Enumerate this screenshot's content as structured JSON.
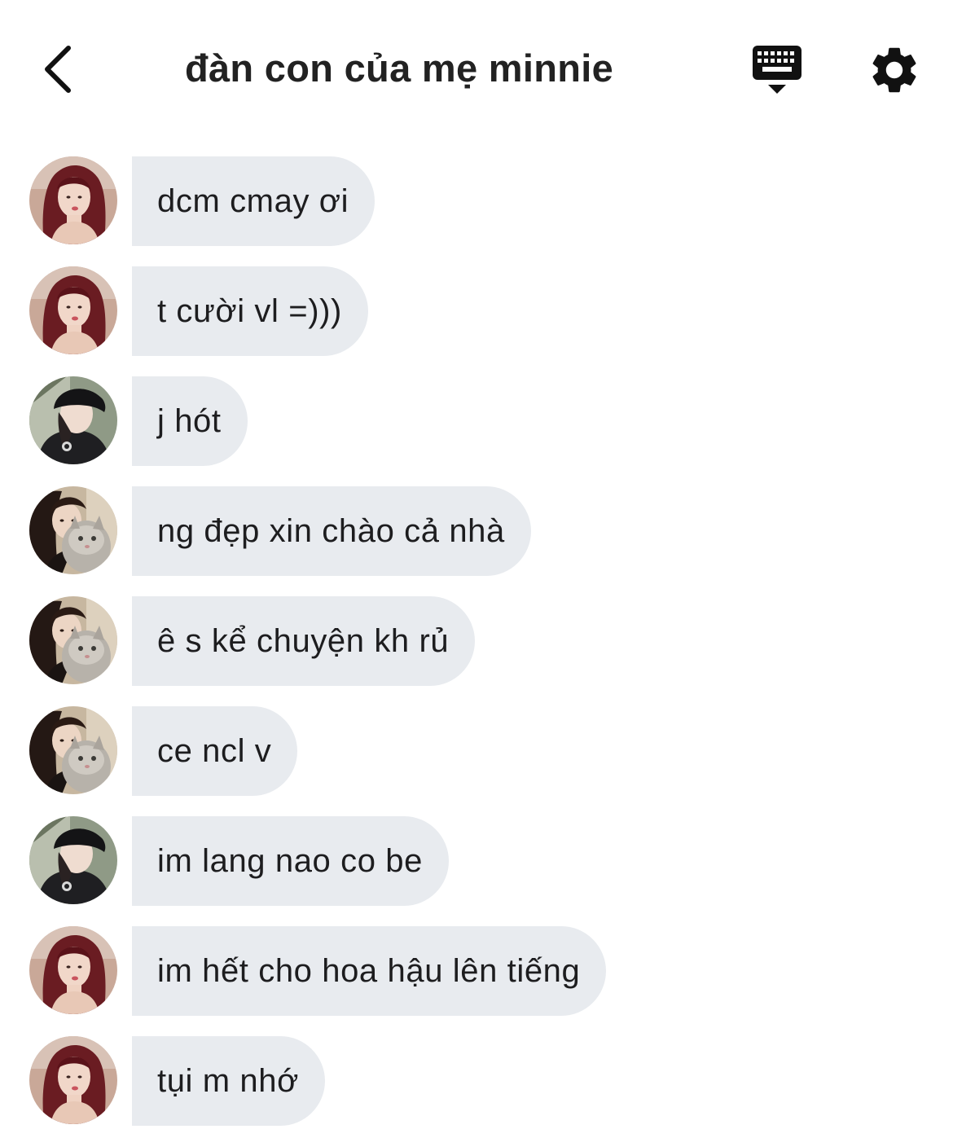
{
  "header": {
    "title": "đàn con của mẹ minnie",
    "back_icon": "chevron-left-icon",
    "keyboard_icon": "keyboard-hide-icon",
    "settings_icon": "gear-icon"
  },
  "colors": {
    "bubble": "#e8ebef",
    "text": "#1d1d1f"
  },
  "messages": [
    {
      "avatar": "red-hair-girl",
      "text": "dcm cmay ơi"
    },
    {
      "avatar": "red-hair-girl",
      "text": "t cười vl =)))"
    },
    {
      "avatar": "black-cap-person",
      "text": "j hót"
    },
    {
      "avatar": "girl-with-cat",
      "text": "ng đẹp xin chào cả nhà"
    },
    {
      "avatar": "girl-with-cat",
      "text": "ê s kể chuyện kh rủ"
    },
    {
      "avatar": "girl-with-cat",
      "text": "ce ncl v"
    },
    {
      "avatar": "black-cap-person",
      "text": "im lang nao co be"
    },
    {
      "avatar": "red-hair-girl",
      "text": "im hết cho hoa hậu lên tiếng"
    },
    {
      "avatar": "red-hair-girl",
      "text": "tụi m nhớ"
    }
  ]
}
